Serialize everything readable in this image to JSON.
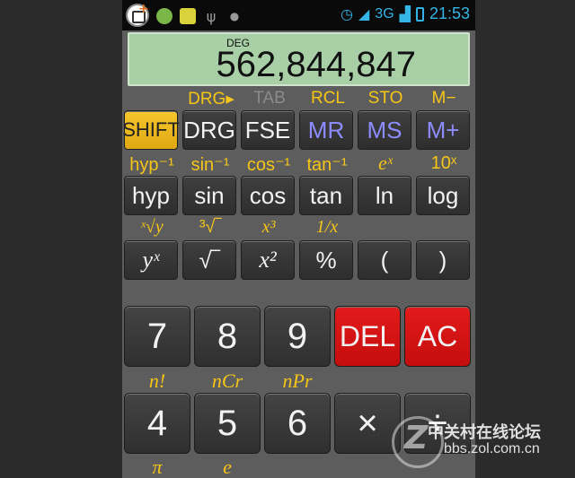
{
  "status_bar": {
    "signal_label": "3G",
    "time": "21:53"
  },
  "display": {
    "mode": "DEG",
    "value": "562,844,847"
  },
  "row1": {
    "labels": [
      "DRG▸",
      "TAB",
      "RCL",
      "STO",
      "M−"
    ],
    "keys": [
      "SHIFT",
      "DRG",
      "FSE",
      "MR",
      "MS",
      "M+"
    ]
  },
  "row2": {
    "labels": [
      "hyp⁻¹",
      "sin⁻¹",
      "cos⁻¹",
      "tan⁻¹",
      "eˣ",
      "10ˣ"
    ],
    "keys": [
      "hyp",
      "sin",
      "cos",
      "tan",
      "ln",
      "log"
    ]
  },
  "row3": {
    "labels": [
      "ˣ√y",
      "³√‾",
      "x³",
      "1/x"
    ],
    "keys": [
      "yˣ",
      "√‾",
      "x²",
      "%",
      "(",
      ")"
    ]
  },
  "numrow1": {
    "keys": [
      "7",
      "8",
      "9",
      "DEL",
      "AC"
    ]
  },
  "numrow2": {
    "labels": [
      "n!",
      "nCr",
      "nPr"
    ],
    "keys": [
      "4",
      "5",
      "6",
      "×",
      "÷"
    ]
  },
  "numrow3": {
    "labels": [
      "π",
      "e"
    ]
  },
  "watermark": {
    "line1": "中关村在线论坛",
    "line2": "bbs.zol.com.cn"
  }
}
